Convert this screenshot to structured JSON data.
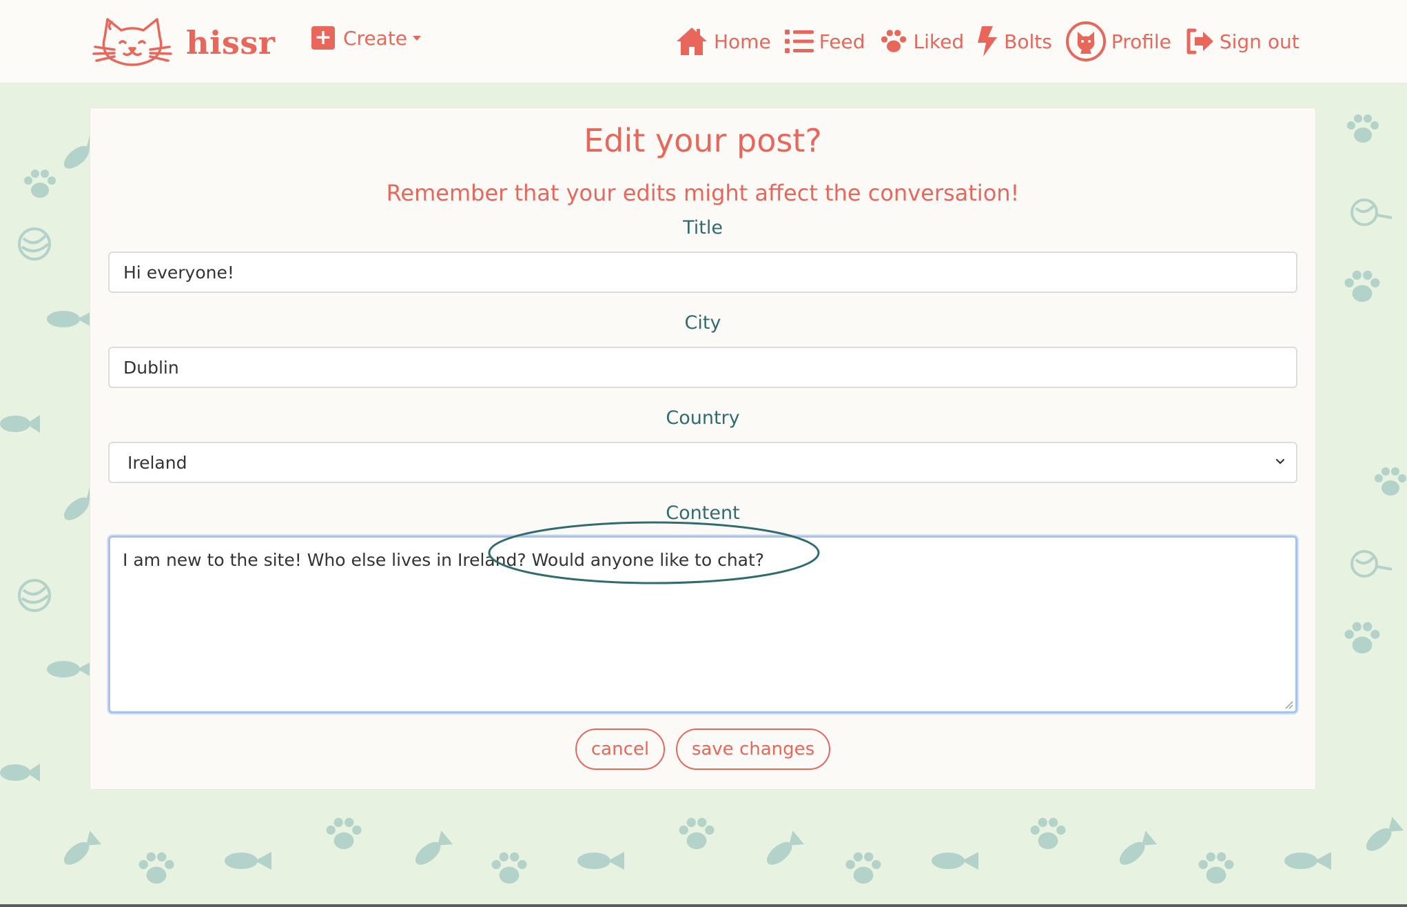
{
  "brand": {
    "name": "hissr",
    "logo_icon": "cat-face-logo"
  },
  "nav": {
    "create_label": "Create",
    "items": [
      {
        "label": "Home",
        "icon": "home-icon"
      },
      {
        "label": "Feed",
        "icon": "list-icon"
      },
      {
        "label": "Liked",
        "icon": "paw-icon"
      },
      {
        "label": "Bolts",
        "icon": "bolt-icon"
      },
      {
        "label": "Profile",
        "icon": "cat-avatar-icon"
      },
      {
        "label": "Sign out",
        "icon": "sign-out-icon"
      }
    ]
  },
  "form": {
    "heading": "Edit your post?",
    "subheading": "Remember that your edits might affect the conversation!",
    "title_label": "Title",
    "title_value": "Hi everyone!",
    "city_label": "City",
    "city_value": "Dublin",
    "country_label": "Country",
    "country_value": "Ireland",
    "content_label": "Content",
    "content_value": "I am new to the site! Who else lives in Ireland? Would anyone like to chat?",
    "cancel_label": "cancel",
    "save_label": "save changes"
  },
  "colors": {
    "accent": "#e8675a",
    "label_teal": "#2f6c70",
    "page_background": "#e7f2e1",
    "pattern": "#b3d2c9"
  }
}
